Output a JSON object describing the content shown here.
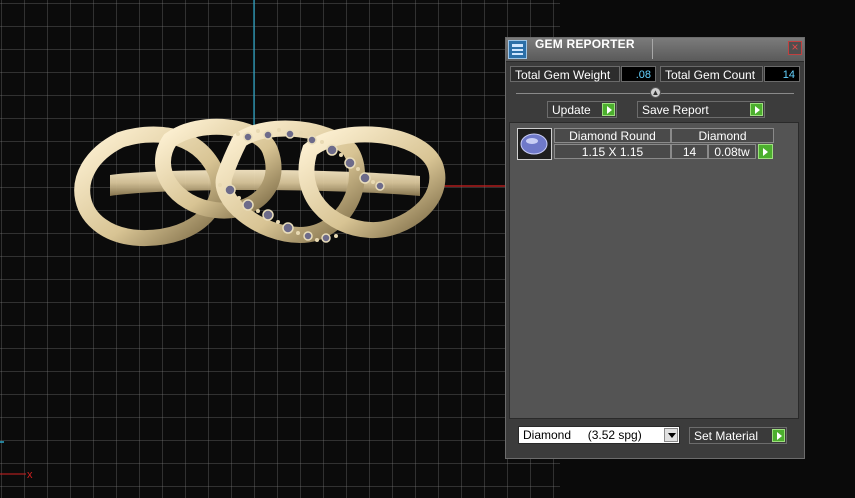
{
  "panel": {
    "title": "GEM REPORTER",
    "total_gem_weight_label": "Total Gem Weight",
    "total_gem_weight_value": ".08",
    "total_gem_count_label": "Total Gem Count",
    "total_gem_count_value": "14",
    "update_label": "Update",
    "save_report_label": "Save Report",
    "gems": [
      {
        "name": "Diamond Round",
        "size": "1.15 X 1.15",
        "material": "Diamond",
        "count": "14",
        "weight": "0.08tw"
      }
    ],
    "material_select_value": "Diamond     (3.52 spg)",
    "set_material_label": "Set Material"
  },
  "viewport": {
    "axis_marker": "x"
  },
  "colors": {
    "panel_bg": "#3c3c3c",
    "value_text": "#63d2ff",
    "arrow_green": "#4caf2e",
    "axis_red": "#d02020",
    "axis_cyan": "#2aa7c9",
    "metal": "#d9c69b"
  },
  "icons": {
    "title": "gem-reporter-app-icon",
    "close": "close-icon",
    "gem_thumb": "diamond-round-icon",
    "arrow": "green-arrow-icon",
    "dropdown": "chevron-down-icon",
    "divider_knob": "collapse-icon"
  }
}
